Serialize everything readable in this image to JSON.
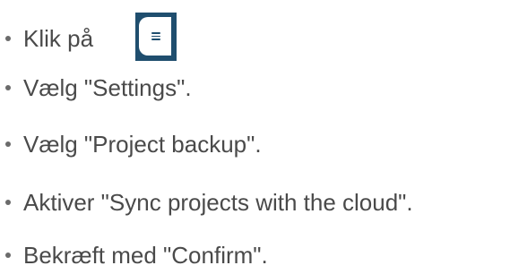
{
  "steps": [
    {
      "text": "Klik på",
      "icon": "menu-icon"
    },
    {
      "text": "Vælg \"Settings\"."
    },
    {
      "text": "Vælg \"Project backup\"."
    },
    {
      "text": "Aktiver \"Sync projects with the cloud\"."
    },
    {
      "text": "Bekræft med \"Confirm\"."
    }
  ],
  "colors": {
    "text": "#4a4a4a",
    "bullet": "#6b6b6b",
    "menu_button_frame": "#1f4e6e",
    "menu_button_face": "#ffffff"
  }
}
